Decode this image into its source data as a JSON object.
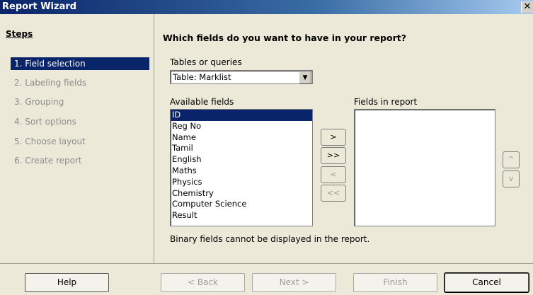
{
  "window": {
    "title": "Report Wizard",
    "close_glyph": "✕"
  },
  "steps": {
    "heading": "Steps",
    "items": [
      {
        "label": "1. Field selection",
        "active": true
      },
      {
        "label": "2. Labeling fields",
        "active": false
      },
      {
        "label": "3. Grouping",
        "active": false
      },
      {
        "label": "4. Sort options",
        "active": false
      },
      {
        "label": "5. Choose layout",
        "active": false
      },
      {
        "label": "6. Create report",
        "active": false
      }
    ]
  },
  "main": {
    "question": "Which fields do you want to have in your report?",
    "tables_label": "Tables or queries",
    "table_selected": "Table: Marklist",
    "available_label": "Available fields",
    "available_fields": [
      "ID",
      "Reg No",
      "Name",
      "Tamil",
      "English",
      "Maths",
      "Physics",
      "Chemistry",
      "Computer Science",
      "Result"
    ],
    "selected_index": 0,
    "report_label": "Fields in report",
    "report_fields": [],
    "note": "Binary fields cannot be displayed in the report."
  },
  "move_buttons": {
    "add": ">",
    "add_all": ">>",
    "remove": "<",
    "remove_all": "<<",
    "up": "^",
    "down": "v"
  },
  "footer": {
    "help": "Help",
    "back": "< Back",
    "next": "Next >",
    "finish": "Finish",
    "cancel": "Cancel"
  }
}
